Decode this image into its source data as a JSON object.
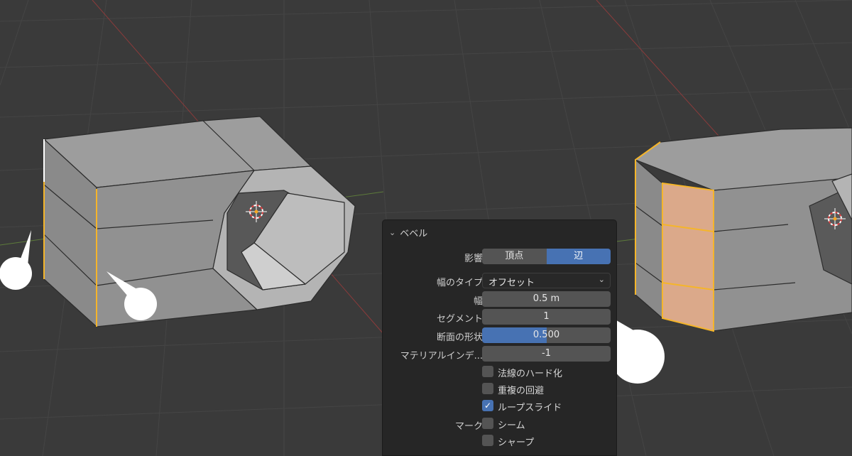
{
  "panel": {
    "title": "ベベル",
    "affect": {
      "label": "影響",
      "options": [
        "頂点",
        "辺"
      ],
      "selected": "辺"
    },
    "width_type": {
      "label": "幅のタイプ",
      "value": "オフセット"
    },
    "width": {
      "label": "幅",
      "value": "0.5 m"
    },
    "segments": {
      "label": "セグメント",
      "value": "1"
    },
    "profile": {
      "label": "断面の形状",
      "value": "0.500",
      "fraction": 0.5
    },
    "material_index": {
      "label": "マテリアルインデ...",
      "value": "-1"
    },
    "harden_normals": {
      "label": "法線のハード化",
      "checked": false
    },
    "clamp_overlap": {
      "label": "重複の回避",
      "checked": false
    },
    "loop_slide": {
      "label": "ループスライド",
      "checked": true
    },
    "mark": {
      "label": "マーク",
      "seam": {
        "label": "シーム",
        "checked": false
      },
      "sharp": {
        "label": "シャープ",
        "checked": false
      }
    }
  },
  "colors": {
    "viewport_bg": "#3a3a3a",
    "accent": "#4772b3",
    "selected_edge": "#f5b52a",
    "panel_bg": "#262626"
  }
}
